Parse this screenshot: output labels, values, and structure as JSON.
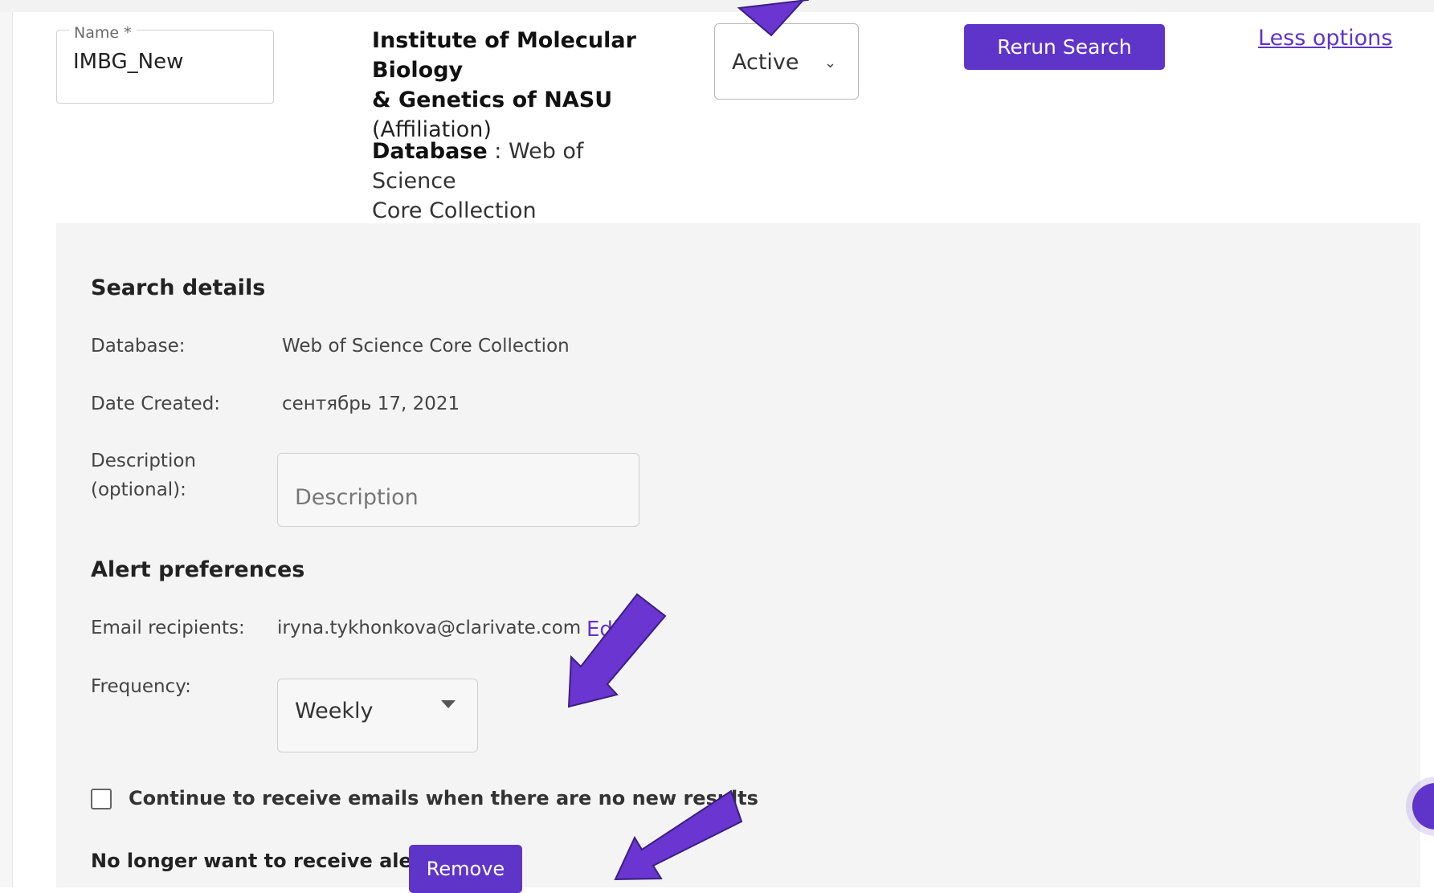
{
  "name_field": {
    "label": "Name *",
    "value": "IMBG_New"
  },
  "affiliation": {
    "name_line1": "Institute of Molecular Biology",
    "name_line2": "& Genetics of NASU",
    "type": "(Affiliation)"
  },
  "database_line": {
    "label": "Database",
    "separator": " : ",
    "value_line1": "Web of Science",
    "value_line2": "Core Collection"
  },
  "status_dropdown": {
    "value": "Active"
  },
  "rerun_label": "Rerun Search",
  "less_options_label": "Less options",
  "search_details": {
    "heading": "Search details",
    "database_label": "Database:",
    "database_value": "Web of Science Core Collection",
    "date_label": "Date Created:",
    "date_value": "сентябрь 17, 2021",
    "description_label_1": "Description",
    "description_label_2": "(optional):",
    "description_placeholder": "Description"
  },
  "alert_preferences": {
    "heading": "Alert preferences",
    "email_label": "Email recipients:",
    "email_value": "iryna.tykhonkova@clarivate.com",
    "edit_label": "Edi",
    "frequency_label": "Frequency:",
    "frequency_value": "Weekly",
    "no_results_checkbox_label": "Continue to receive emails when there are no new results",
    "no_results_checked": false,
    "remove_prompt": "No longer want to receive alerts?",
    "remove_label": "Remove"
  },
  "colors": {
    "accent": "#5f35c9",
    "panel_bg": "#f4f4f4",
    "arrow_fill": "#6a35d0"
  }
}
